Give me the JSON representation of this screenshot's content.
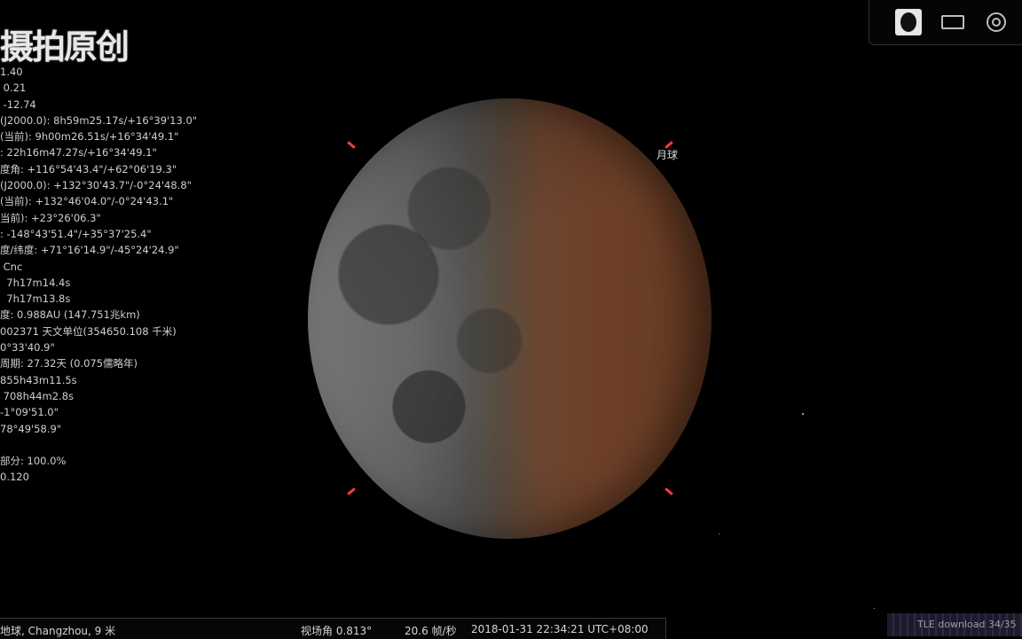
{
  "watermark": "摄拍原创",
  "info_lines": [
    "1.40",
    " 0.21",
    " -12.74",
    "(J2000.0): 8h59m25.17s/+16°39'13.0\"",
    "(当前): 9h00m26.51s/+16°34'49.1\"",
    ": 22h16m47.27s/+16°34'49.1\"",
    "度角: +116°54'43.4\"/+62°06'19.3\"",
    "(J2000.0): +132°30'43.7\"/-0°24'48.8\"",
    "(当前): +132°46'04.0\"/-0°24'43.1\"",
    "当前): +23°26'06.3\"",
    ": -148°43'51.4\"/+35°37'25.4\"",
    "度/纬度: +71°16'14.9\"/-45°24'24.9\"",
    " Cnc",
    "  7h17m14.4s",
    "  7h17m13.8s",
    "度: 0.988AU (147.751兆km)",
    "002371 天文单位(354650.108 千米)",
    "0°33'40.9\"",
    "周期: 27.32天 (0.075儒略年)",
    "855h43m11.5s",
    " 708h44m2.8s",
    "-1°09'51.0\"",
    "78°49'58.9\"",
    "",
    "部分: 100.0%",
    "0.120"
  ],
  "object_label": "月球",
  "colors": {
    "marker": "#ff3b3b",
    "moon_lit": "#8a8a8a",
    "moon_umbra": "#6e4029",
    "background": "#000000"
  },
  "toolbar": {
    "buttons": [
      {
        "icon": "moon-view-icon",
        "active": true
      },
      {
        "icon": "rectangle-icon",
        "active": false
      },
      {
        "icon": "target-icon",
        "active": false
      }
    ]
  },
  "statusbar": {
    "location": "地球, Changzhou, 9 米",
    "fov": "视场角 0.813°",
    "fps": "20.6 帧/秒",
    "datetime": "2018-01-31 22:34:21 UTC+08:00"
  },
  "tle_status": "TLE download 34/35"
}
